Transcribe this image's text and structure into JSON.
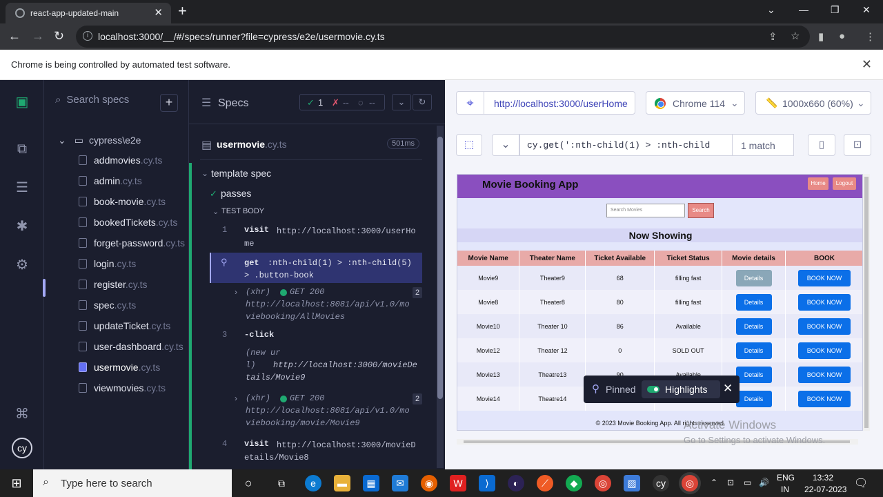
{
  "browser": {
    "tab_title": "react-app-updated-main",
    "url": "localhost:3000/__/#/specs/runner?file=cypress/e2e/usermovie.cy.ts",
    "infobar": "Chrome is being controlled by automated test software."
  },
  "specs_panel": {
    "search_placeholder": "Search specs",
    "folder": "cypress\\e2e",
    "items": [
      {
        "name": "addmovies",
        "ext": ".cy.ts"
      },
      {
        "name": "admin",
        "ext": ".cy.ts"
      },
      {
        "name": "book-movie",
        "ext": ".cy.ts"
      },
      {
        "name": "bookedTickets",
        "ext": ".cy.ts"
      },
      {
        "name": "forget-password",
        "ext": ".cy.ts"
      },
      {
        "name": "login",
        "ext": ".cy.ts"
      },
      {
        "name": "register",
        "ext": ".cy.ts"
      },
      {
        "name": "spec",
        "ext": ".cy.ts"
      },
      {
        "name": "updateTicket",
        "ext": ".cy.ts"
      },
      {
        "name": "user-dashboard",
        "ext": ".cy.ts"
      },
      {
        "name": "usermovie",
        "ext": ".cy.ts"
      },
      {
        "name": "viewmovies",
        "ext": ".cy.ts"
      }
    ],
    "active_index": 10
  },
  "reporter": {
    "title": "Specs",
    "passed": "1",
    "failed": "--",
    "pending": "--",
    "spec_name": "usermovie",
    "spec_ext": ".cy.ts",
    "duration": "501ms",
    "suite": "template spec",
    "test": "passes",
    "test_body": "TEST BODY",
    "commands": [
      {
        "num": "1",
        "name": "visit",
        "value": "http://localhost:3000/userHome"
      },
      {
        "num": "",
        "name": "get",
        "value": ":nth-child(1) > :nth-child(5) > .button-book"
      },
      {
        "xhr": "(xhr)",
        "method": "GET 200",
        "url": "http://localhost:8081/api/v1.0/moviebooking/AllMovies",
        "count": "2"
      },
      {
        "num": "3",
        "name": "-click"
      },
      {
        "new_url_label": "(new url)",
        "new_url": "http://localhost:3000/movieDetails/Movie9"
      },
      {
        "xhr": "(xhr)",
        "method": "GET 200",
        "url": "http://localhost:8081/api/v1.0/moviebooking/movie/Movie9",
        "count": "2"
      },
      {
        "num": "4",
        "name": "visit",
        "value": "http://localhost:3000/movieDetails/Movie8"
      }
    ]
  },
  "aut": {
    "url": "http://localhost:3000/userHome",
    "browser": "Chrome 114",
    "viewport": "1000x660 (60%)",
    "selector_prefix": "cy.get(",
    "selector": "':nth-child(1) > :nth-child",
    "match": "1 match"
  },
  "app": {
    "title": "Movie Booking App",
    "nav_home": "Home",
    "nav_logout": "Logout",
    "search_placeholder": "Search Movies",
    "search_btn": "Search",
    "now_showing": "Now Showing",
    "columns": [
      "Movie Name",
      "Theater Name",
      "Ticket Available",
      "Ticket Status",
      "Movie details",
      "BOOK"
    ],
    "rows": [
      [
        "Movie9",
        "Theater9",
        "68",
        "filling fast"
      ],
      [
        "Movie8",
        "Theater8",
        "80",
        "filling fast"
      ],
      [
        "Movie10",
        "Theater 10",
        "86",
        "Available"
      ],
      [
        "Movie12",
        "Theater 12",
        "0",
        "SOLD OUT"
      ],
      [
        "Movie13",
        "Theatre13",
        "90",
        "Available"
      ],
      [
        "Movie14",
        "Theatre14",
        "",
        ""
      ]
    ],
    "details_label": "Details",
    "book_label": "BOOK NOW",
    "footer": "© 2023 Movie Booking App. All rights reserved."
  },
  "pinned": {
    "label": "Pinned",
    "highlights": "Highlights"
  },
  "watermark": {
    "title": "Activate Windows",
    "sub": "Go to Settings to activate Windows."
  },
  "taskbar": {
    "search_placeholder": "Type here to search",
    "lang": "ENG",
    "region": "IN",
    "time": "13:32",
    "date": "22-07-2023"
  }
}
